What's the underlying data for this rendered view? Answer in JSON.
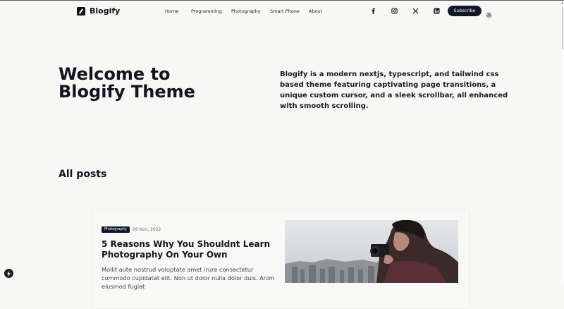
{
  "header": {
    "logo_text": "Blogify",
    "nav": [
      "Home",
      "Programming",
      "Photography",
      "Smart Phone",
      "About"
    ],
    "social_icons": [
      "facebook-icon",
      "instagram-icon",
      "x-icon",
      "linkedin-icon"
    ],
    "subscribe_label": "Subscribe",
    "theme_icon": "sun-icon"
  },
  "hero": {
    "title_line1": "Welcome to",
    "title_line2": "Blogify Theme",
    "description": "Blogify is a modern nextjs, typescript, and tailwind css based theme featuring captivating page transitions, a unique custom cursor, and a sleek scrollbar, all enhanced with smooth scrolling."
  },
  "posts_section": {
    "title": "All posts",
    "posts": [
      {
        "category": "Photography",
        "date": "09 Nov, 2022",
        "title": "5 Reasons Why You Shouldnt Learn Photography On Your Own",
        "excerpt": "Mollit aute nostrud voluptate amet irure consectetur commodo cupidatat elit. Non ut dolor nulla dolor duis. Anim eiusmod fugiat"
      }
    ]
  },
  "colors": {
    "background": "#f7f7f6",
    "text": "#12121a",
    "button_bg": "#0f1729",
    "badge_bg": "#111827"
  }
}
